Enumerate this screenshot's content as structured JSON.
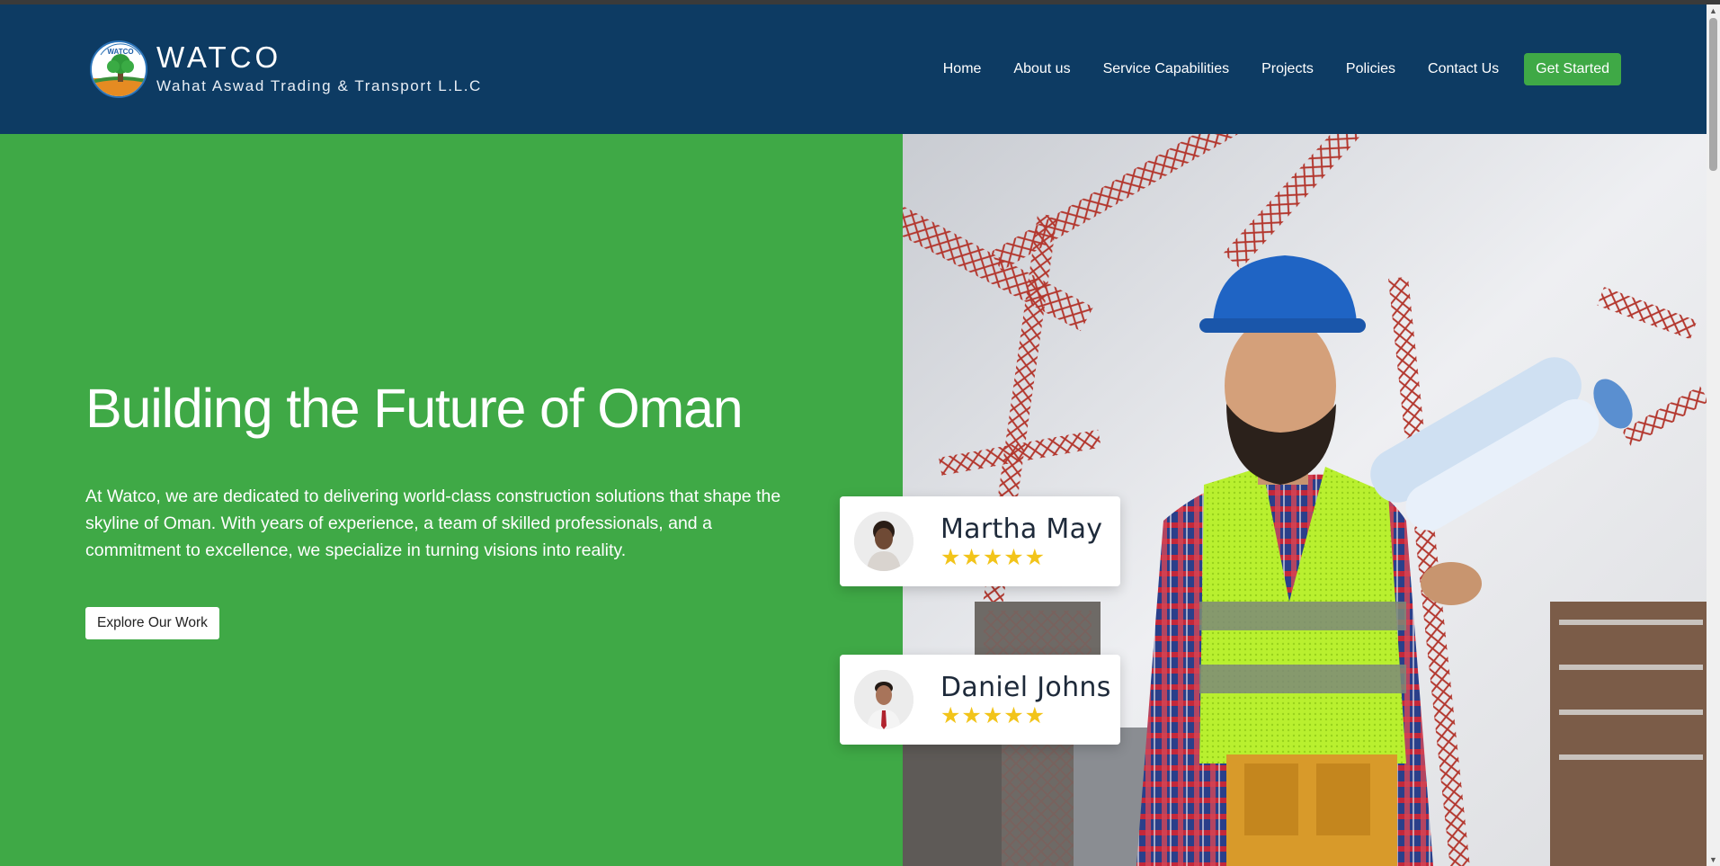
{
  "header": {
    "brand": "WATCO",
    "brand_subtitle": "Wahat Aswad Trading & Transport L.L.C",
    "logo_badge_text": "WATCO",
    "nav": [
      {
        "label": "Home"
      },
      {
        "label": "About us"
      },
      {
        "label": "Service Capabilities"
      },
      {
        "label": "Projects"
      },
      {
        "label": "Policies"
      },
      {
        "label": "Contact Us"
      }
    ],
    "cta_label": "Get Started"
  },
  "hero": {
    "title": "Building the Future of Oman",
    "description": "At Watco, we are dedicated to delivering world-class construction solutions that shape the skyline of Oman. With years of experience, a team of skilled professionals, and a commitment to excellence, we specialize in turning visions into reality.",
    "button_label": "Explore Our Work"
  },
  "reviews": [
    {
      "name": "Martha May",
      "stars": "★★★★★",
      "rating": 5
    },
    {
      "name": "Daniel Johns",
      "stars": "★★★★★",
      "rating": 5
    }
  ],
  "colors": {
    "header_bg": "#0d3b63",
    "hero_green": "#3fa946",
    "star": "#f2c41a"
  },
  "icons": [
    "watco-logo-icon",
    "scroll-up-icon",
    "scroll-down-icon"
  ]
}
